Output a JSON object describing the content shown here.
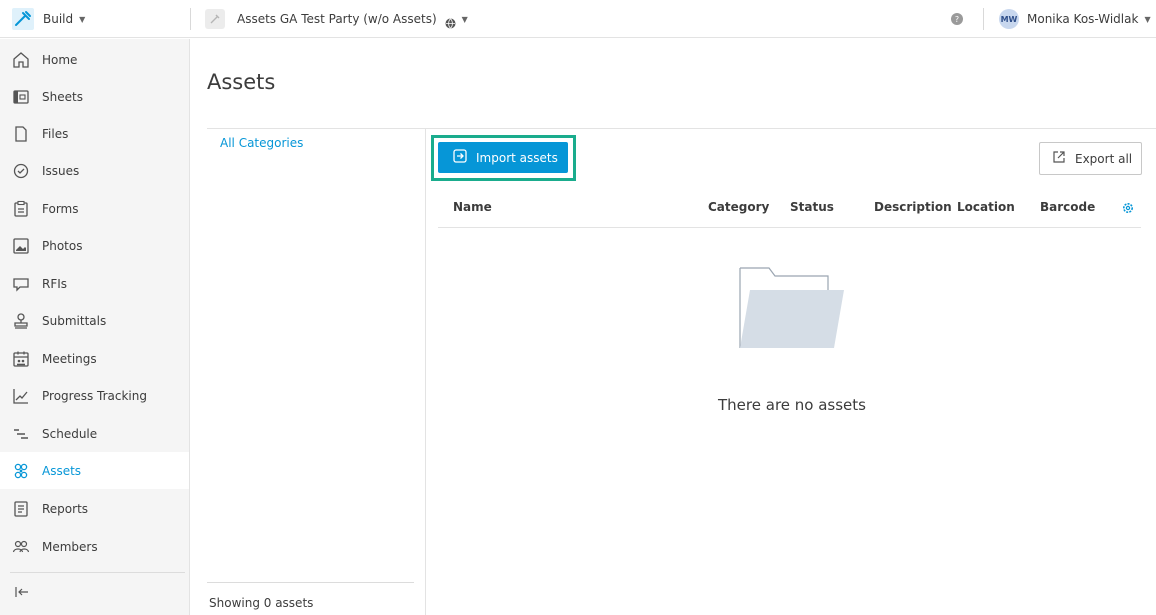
{
  "topbar": {
    "product": "Build",
    "project": "Assets GA Test Party (w/o Assets)",
    "user_initials": "MW",
    "user_name": "Monika Kos-Widlak"
  },
  "sidebar": {
    "items": [
      {
        "label": "Home",
        "icon": "home-icon"
      },
      {
        "label": "Sheets",
        "icon": "sheets-icon"
      },
      {
        "label": "Files",
        "icon": "files-icon"
      },
      {
        "label": "Issues",
        "icon": "issues-icon"
      },
      {
        "label": "Forms",
        "icon": "forms-icon"
      },
      {
        "label": "Photos",
        "icon": "photos-icon"
      },
      {
        "label": "RFIs",
        "icon": "rfis-icon"
      },
      {
        "label": "Submittals",
        "icon": "submittals-icon"
      },
      {
        "label": "Meetings",
        "icon": "meetings-icon"
      },
      {
        "label": "Progress Tracking",
        "icon": "progress-tracking-icon"
      },
      {
        "label": "Schedule",
        "icon": "schedule-icon"
      },
      {
        "label": "Assets",
        "icon": "assets-icon",
        "active": true
      },
      {
        "label": "Reports",
        "icon": "reports-icon"
      },
      {
        "label": "Members",
        "icon": "members-icon"
      }
    ]
  },
  "page": {
    "title": "Assets",
    "category_link": "All Categories",
    "showing": "Showing 0 assets",
    "import_label": "Import assets",
    "export_label": "Export all",
    "empty_text": "There are no assets"
  },
  "table": {
    "columns": [
      "Name",
      "Category",
      "Status",
      "Description",
      "Location",
      "Barcode"
    ]
  },
  "colors": {
    "accent": "#0696d7",
    "highlight": "#1aac8d",
    "sidebar_bg": "#f5f5f5"
  }
}
